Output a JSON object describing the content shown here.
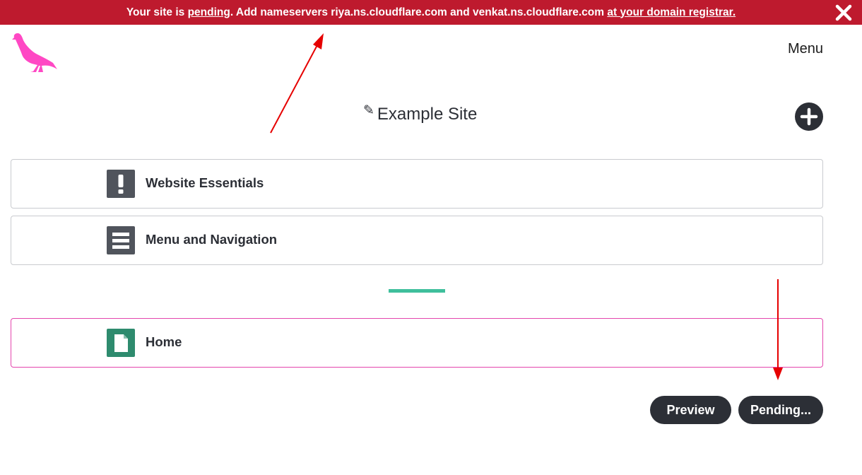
{
  "banner": {
    "text_prefix": "Your site is ",
    "pending_link": "pending",
    "text_middle": ". Add nameservers riya.ns.cloudflare.com and venkat.ns.cloudflare.com ",
    "registrar_link": "at your domain registrar.",
    "background_color": "#be1a2e"
  },
  "header": {
    "logo_icon": "pigeon-logo-icon",
    "logo_color": "#ff48c4",
    "menu_label": "Menu"
  },
  "site": {
    "edit_icon": "pencil-icon",
    "edit_glyph": "✎",
    "title": "Example Site",
    "add_icon": "plus-icon"
  },
  "sections": [
    {
      "label": "Website Essentials",
      "icon": "exclamation-icon",
      "icon_color": "#50545c"
    },
    {
      "label": "Menu and Navigation",
      "icon": "list-icon",
      "icon_color": "#50545c"
    }
  ],
  "divider_color": "#3fbf9c",
  "pages": [
    {
      "label": "Home",
      "icon": "page-icon",
      "icon_color": "#2e8b6e"
    }
  ],
  "actions": {
    "preview_label": "Preview",
    "pending_label": "Pending..."
  },
  "annotation_color": "#e60000"
}
